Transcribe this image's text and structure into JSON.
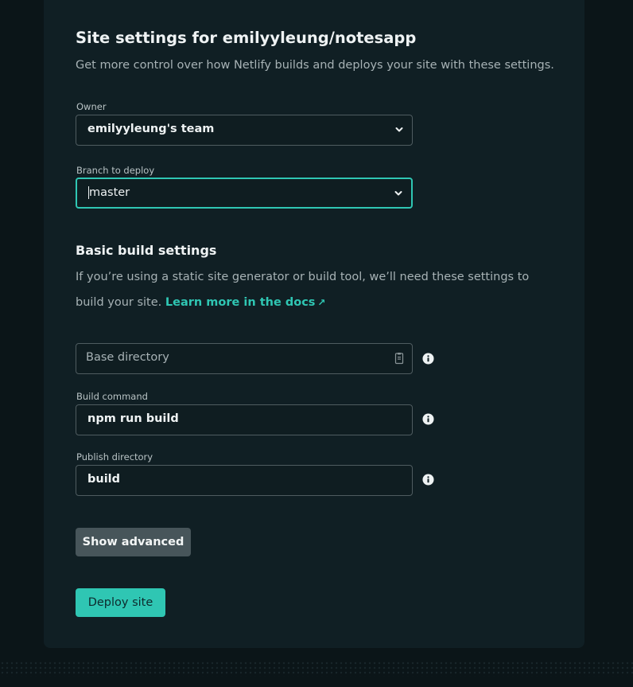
{
  "header": {
    "title": "Site settings for emilyyleung/notesapp",
    "subtitle": "Get more control over how Netlify builds and deploys your site with these settings."
  },
  "owner": {
    "label": "Owner",
    "value": "emilyyleung's team"
  },
  "branch": {
    "label": "Branch to deploy",
    "value": "master"
  },
  "build_settings": {
    "title": "Basic build settings",
    "description": "If you’re using a static site generator or build tool, we’ll need these settings to build your site.",
    "link_text": "Learn more in the docs",
    "link_arrow": "↗",
    "base_directory": {
      "placeholder": "Base directory",
      "value": ""
    },
    "build_command": {
      "label": "Build command",
      "value": "npm run build"
    },
    "publish_directory": {
      "label": "Publish directory",
      "value": "build"
    }
  },
  "buttons": {
    "show_advanced": "Show advanced",
    "deploy": "Deploy site"
  },
  "colors": {
    "accent": "#2fc6b3",
    "background": "#0b1518",
    "card": "#101f24"
  }
}
